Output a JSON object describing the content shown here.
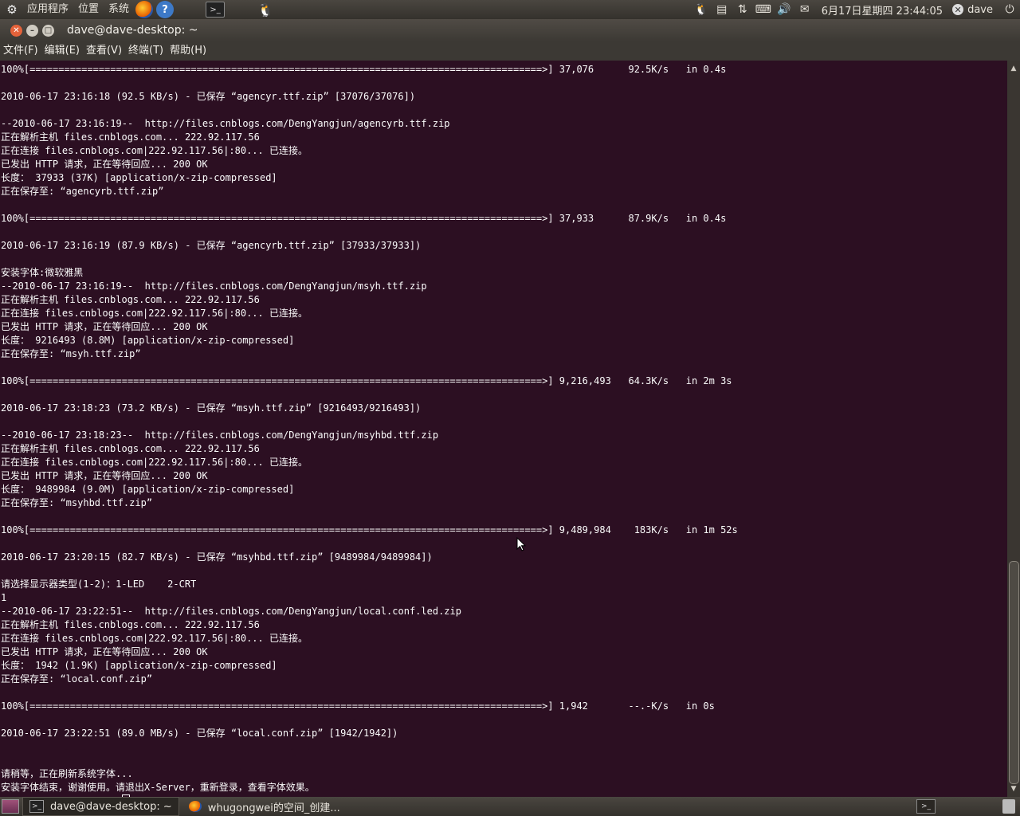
{
  "top_panel": {
    "menus": [
      "应用程序",
      "位置",
      "系统"
    ],
    "clock": "6月17日星期四 23:44:05",
    "user": "dave",
    "icons": [
      "ubuntu-logo-icon",
      "firefox-icon",
      "help-icon",
      "terminal-icon",
      "qq-icon",
      "tray-icons",
      "mail-icon",
      "volume-icon",
      "keyboard-icon",
      "network-icon",
      "power-icon"
    ]
  },
  "window": {
    "title": "dave@dave-desktop: ~",
    "menus": [
      "文件(F)",
      "编辑(E)",
      "查看(V)",
      "终端(T)",
      "帮助(H)"
    ]
  },
  "terminal": {
    "lines": [
      "100%[=========================================================================================>] 37,076      92.5K/s   in 0.4s",
      "",
      "2010-06-17 23:16:18 (92.5 KB/s) - 已保存 “agencyr.ttf.zip” [37076/37076])",
      "",
      "--2010-06-17 23:16:19--  http://files.cnblogs.com/DengYangjun/agencyrb.ttf.zip",
      "正在解析主机 files.cnblogs.com... 222.92.117.56",
      "正在连接 files.cnblogs.com|222.92.117.56|:80... 已连接。",
      "已发出 HTTP 请求，正在等待回应... 200 OK",
      "长度： 37933 (37K) [application/x-zip-compressed]",
      "正在保存至: “agencyrb.ttf.zip”",
      "",
      "100%[=========================================================================================>] 37,933      87.9K/s   in 0.4s",
      "",
      "2010-06-17 23:16:19 (87.9 KB/s) - 已保存 “agencyrb.ttf.zip” [37933/37933])",
      "",
      "安装字体:微软雅黑",
      "--2010-06-17 23:16:19--  http://files.cnblogs.com/DengYangjun/msyh.ttf.zip",
      "正在解析主机 files.cnblogs.com... 222.92.117.56",
      "正在连接 files.cnblogs.com|222.92.117.56|:80... 已连接。",
      "已发出 HTTP 请求，正在等待回应... 200 OK",
      "长度： 9216493 (8.8M) [application/x-zip-compressed]",
      "正在保存至: “msyh.ttf.zip”",
      "",
      "100%[=========================================================================================>] 9,216,493   64.3K/s   in 2m 3s",
      "",
      "2010-06-17 23:18:23 (73.2 KB/s) - 已保存 “msyh.ttf.zip” [9216493/9216493])",
      "",
      "--2010-06-17 23:18:23--  http://files.cnblogs.com/DengYangjun/msyhbd.ttf.zip",
      "正在解析主机 files.cnblogs.com... 222.92.117.56",
      "正在连接 files.cnblogs.com|222.92.117.56|:80... 已连接。",
      "已发出 HTTP 请求，正在等待回应... 200 OK",
      "长度： 9489984 (9.0M) [application/x-zip-compressed]",
      "正在保存至: “msyhbd.ttf.zip”",
      "",
      "100%[=========================================================================================>] 9,489,984    183K/s   in 1m 52s",
      "",
      "2010-06-17 23:20:15 (82.7 KB/s) - 已保存 “msyhbd.ttf.zip” [9489984/9489984])",
      "",
      "请选择显示器类型(1-2)：1-LED    2-CRT",
      "1",
      "--2010-06-17 23:22:51--  http://files.cnblogs.com/DengYangjun/local.conf.led.zip",
      "正在解析主机 files.cnblogs.com... 222.92.117.56",
      "正在连接 files.cnblogs.com|222.92.117.56|:80... 已连接。",
      "已发出 HTTP 请求，正在等待回应... 200 OK",
      "长度： 1942 (1.9K) [application/x-zip-compressed]",
      "正在保存至: “local.conf.zip”",
      "",
      "100%[=========================================================================================>] 1,942       --.-K/s   in 0s",
      "",
      "2010-06-17 23:22:51 (89.0 MB/s) - 已保存 “local.conf.zip” [1942/1942])",
      "",
      "",
      "请稍等，正在刷新系统字体...",
      "安装字体结束，谢谢使用。请退出X-Server，重新登录，查看字体效果。"
    ],
    "prompt": "dave@dave-desktop:~$ "
  },
  "taskbar": {
    "tasks": [
      {
        "label": "dave@dave-desktop: ~",
        "icon": "terminal-icon",
        "active": true
      },
      {
        "label": "whugongwei的空间_创建...",
        "icon": "firefox-icon",
        "active": false
      }
    ]
  }
}
